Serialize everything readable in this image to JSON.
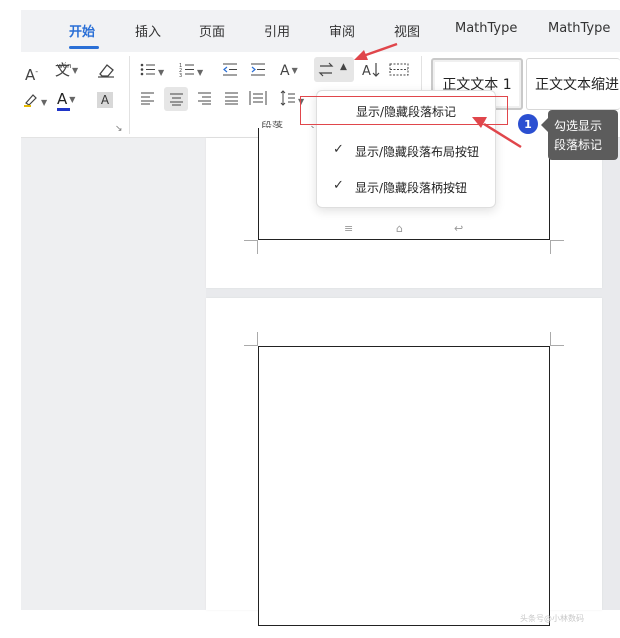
{
  "tabs": [
    {
      "label": "开始",
      "active": true
    },
    {
      "label": "插入"
    },
    {
      "label": "页面"
    },
    {
      "label": "引用"
    },
    {
      "label": "审阅"
    },
    {
      "label": "视图"
    },
    {
      "label": "MathType"
    },
    {
      "label": "MathType"
    }
  ],
  "toolbar": {
    "font_size_up": "A",
    "font_size_up_sup": "+",
    "font_size_down": "A",
    "font_size_down_sup": "-",
    "pinyin_label": "wén",
    "pinyin_char": "文",
    "clear_format": "⌫",
    "font_color_letter": "A",
    "char_shading_letter": "A",
    "ai_letter": "A",
    "group_label": "段落",
    "launcher": "↘",
    "styles": [
      "正文文本 1",
      "正文文本缩进"
    ]
  },
  "dropdown": {
    "items": [
      {
        "label": "显示/隐藏段落标记",
        "checked": false
      },
      {
        "label": "显示/隐藏段落布局按钮",
        "checked": true
      },
      {
        "label": "显示/隐藏段落柄按钮",
        "checked": true
      }
    ]
  },
  "annotation": {
    "number": "1",
    "text_line1": "勾选显示",
    "text_line2": "段落标记"
  },
  "colors": {
    "accent": "#2a6fd6",
    "arrow": "#e0464b",
    "font_color_bar": "#1f35c8"
  },
  "watermark": "头条号@小林数码"
}
